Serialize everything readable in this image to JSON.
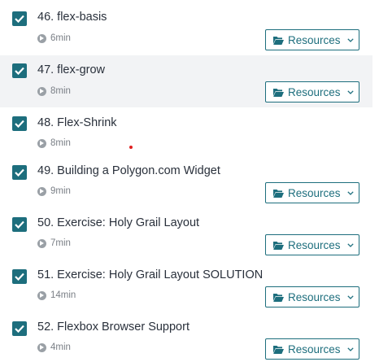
{
  "lectures": [
    {
      "title": "46. flex-basis",
      "duration": "6min",
      "completed": true,
      "has_resources": true,
      "resources_label": "Resources"
    },
    {
      "title": "47. flex-grow",
      "duration": "8min",
      "completed": true,
      "has_resources": true,
      "resources_label": "Resources"
    },
    {
      "title": "48. Flex-Shrink",
      "duration": "8min",
      "completed": true,
      "has_resources": false
    },
    {
      "title": "49. Building a Polygon.com Widget",
      "duration": "9min",
      "completed": true,
      "has_resources": true,
      "resources_label": "Resources"
    },
    {
      "title": "50. Exercise: Holy Grail Layout",
      "duration": "7min",
      "completed": true,
      "has_resources": true,
      "resources_label": "Resources"
    },
    {
      "title": "51. Exercise: Holy Grail Layout SOLUTION",
      "duration": "14min",
      "completed": true,
      "has_resources": true,
      "resources_label": "Resources"
    },
    {
      "title": "52. Flexbox Browser Support",
      "duration": "4min",
      "completed": true,
      "has_resources": true,
      "resources_label": "Resources"
    }
  ],
  "icons": {
    "checkbox": "checkbox-checked-icon",
    "play": "play-circle-icon",
    "folder": "folder-open-icon",
    "chevron": "chevron-down-icon"
  },
  "colors": {
    "accent": "#1d6e7d",
    "row_highlight": "#f2f3f5",
    "title_text": "#29303b",
    "meta_text": "#7a7f86"
  }
}
